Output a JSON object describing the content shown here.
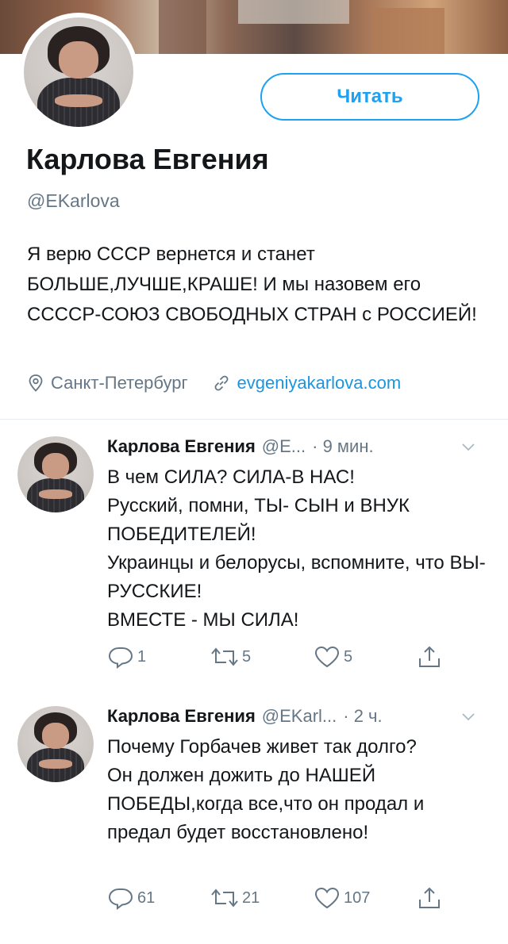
{
  "profile": {
    "name": "Карлова Евгения",
    "handle": "@EKarlova",
    "follow_label": "Читать",
    "bio": "Я верю СССР вернется и станет БОЛЬШЕ,ЛУЧШЕ,КРАШЕ! И мы назовем его СССCР-СОЮЗ СВОБОДНЫХ СТРАН с РОССИЕЙ!",
    "location": "Санкт-Петербург",
    "website": "evgeniyakarlova.com"
  },
  "tweets": [
    {
      "name": "Карлова Евгения",
      "handle": "@E...",
      "time": "· 9 мин.",
      "text": "В чем СИЛА? СИЛА-В НАС!\nРусский, помни, ТЫ- СЫН и ВНУК ПОБЕДИТЕЛЕЙ!\nУкраинцы и белорусы, вспомните, что ВЫ-РУССКИЕ!\nВМЕСТЕ - МЫ СИЛА!",
      "replies": "1",
      "retweets": "5",
      "likes": "5"
    },
    {
      "name": "Карлова Евгения",
      "handle": "@EKarl...",
      "time": "· 2 ч.",
      "text": "Почему Горбачев живет так долго?\nОн должен дожить до НАШЕЙ ПОБЕДЫ,когда все,что он продал и предал будет восстановлено!",
      "replies": "61",
      "retweets": "21",
      "likes": "107"
    }
  ],
  "colors": {
    "accent": "#1da1f2",
    "secondary_text": "#657786",
    "link": "#1b95e0"
  },
  "icons": [
    "location-pin-icon",
    "link-icon",
    "reply-icon",
    "retweet-icon",
    "like-icon",
    "share-icon",
    "chevron-down-icon"
  ]
}
